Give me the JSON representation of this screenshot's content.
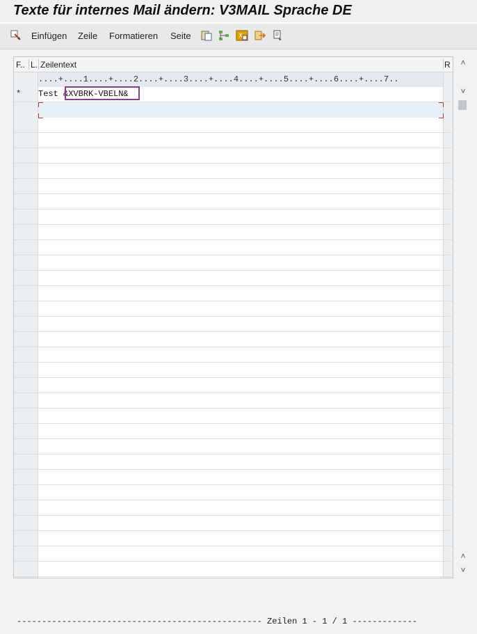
{
  "window": {
    "title": "Texte für internes Mail ändern: V3MAIL Sprache DE"
  },
  "toolbar": {
    "menu_items": [
      "Einfügen",
      "Zeile",
      "Formatieren",
      "Seite"
    ],
    "icons": [
      "edit-settings-icon",
      "paste-icon",
      "tree-icon",
      "format-icon",
      "export-icon",
      "copy-doc-icon"
    ]
  },
  "grid": {
    "headers": {
      "col_format": "F..",
      "col_line": "L.",
      "col_text": "Zeilentext",
      "col_right": "R"
    },
    "ruler": "....+....1....+....2....+....3....+....4....+....5....+....6....+....7..",
    "rows": [
      {
        "flag": "*",
        "text_prefix": "Test ",
        "text_var": "&XVBRK-VBELN&"
      }
    ]
  },
  "scroll": {
    "up": "˄",
    "down": "˅"
  },
  "footer": {
    "text": "------------------------------------------------- Zeilen 1 - 1 / 1 -------------"
  },
  "colors": {
    "highlight": "#8b3c8b",
    "active_row": "#e5f0f8",
    "cursor_marker": "#c0392b"
  }
}
